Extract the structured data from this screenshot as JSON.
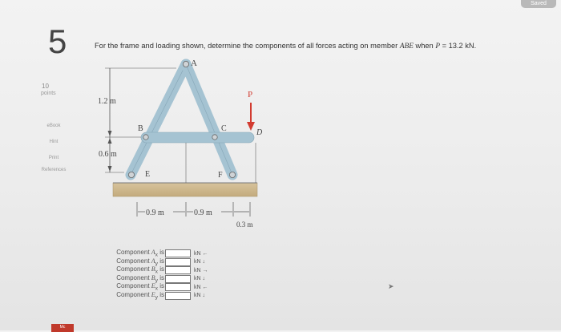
{
  "status": {
    "saved": "Saved"
  },
  "question": {
    "number": "5",
    "points_value": "10",
    "points_label": "points",
    "prompt_before": "For the frame and loading shown, determine the components of all forces acting on member ",
    "prompt_member": "ABE",
    "prompt_middle": " when ",
    "prompt_var": "P",
    "prompt_after": " = 13.2 kN."
  },
  "sidebar": {
    "links": [
      {
        "label": "eBook"
      },
      {
        "label": "Hint"
      },
      {
        "label": "Print"
      },
      {
        "label": "References"
      }
    ]
  },
  "figure": {
    "labels": {
      "A": "A",
      "B": "B",
      "C": "C",
      "D": "D",
      "E": "E",
      "F": "F",
      "P": "P",
      "dim_12": "1.2 m",
      "dim_06": "0.6 m",
      "dim_09a": "0.9 m",
      "dim_09b": "0.9 m",
      "dim_03": "0.3 m"
    }
  },
  "answers": [
    {
      "label_pre": "Component ",
      "symbol": "A",
      "sub": "x",
      "label_post": " is",
      "value": "",
      "unit": "kN ←"
    },
    {
      "label_pre": "Component ",
      "symbol": "A",
      "sub": "y",
      "label_post": " is",
      "value": "",
      "unit": "kN ↓"
    },
    {
      "label_pre": "Component ",
      "symbol": "B",
      "sub": "x",
      "label_post": " is",
      "value": "",
      "unit": "kN →"
    },
    {
      "label_pre": "Component ",
      "symbol": "B",
      "sub": "y",
      "label_post": " is",
      "value": "",
      "unit": "kN ↓"
    },
    {
      "label_pre": "Component ",
      "symbol": "E",
      "sub": "x",
      "label_post": " is",
      "value": "",
      "unit": "kN ←"
    },
    {
      "label_pre": "Component ",
      "symbol": "E",
      "sub": "y",
      "label_post": " is",
      "value": "",
      "unit": "kN ↓"
    }
  ],
  "footer": {
    "badge": "Mc"
  }
}
